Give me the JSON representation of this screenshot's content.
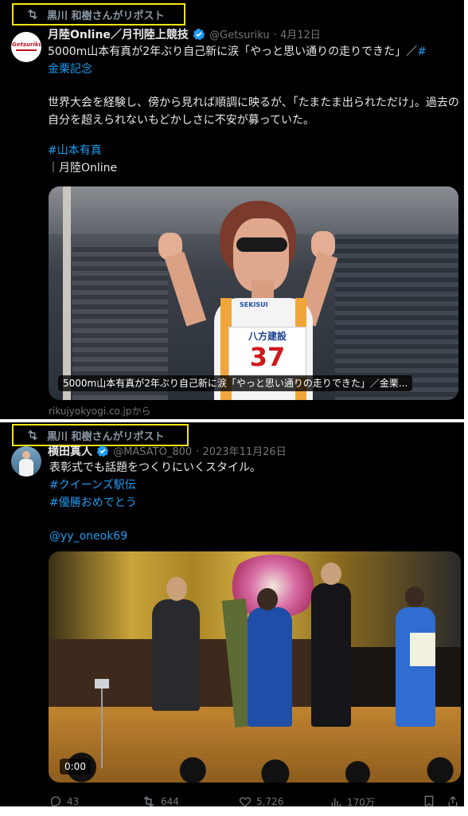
{
  "tweet1": {
    "retweeted_by": "黒川 和樹さんがリポスト",
    "avatar_text": "Getsuriku",
    "author_name": "月陸Online／月刊陸上競技",
    "handle": "@Getsuriku",
    "date": "· 4月12日",
    "headline_a": "5000m山本有真が2年ぶり自己新に涙「やっと思い通りの走りできた」／",
    "headline_hashtag_a": "#",
    "headline_hashtag_b": "金栗記念",
    "paragraph": "世界大会を経験し、傍から見れば順調に映るが、「たまたま出られただけ」。過去の自分を超えられないもどかしさに不安が募っていた。",
    "hashtag": "#山本有真",
    "source_line": "｜月陸Online",
    "card_caption": "5000m山本有真が2年ぶり自己新に涙「やっと思い通りの走りできた」／金栗...",
    "card_domain": "rikujyokyogi.co.jpから",
    "bib_sponsor": "八方建設",
    "bib_number": "37",
    "shirt_brand": "SEKISUI"
  },
  "tweet2": {
    "retweeted_by": "黒川 和樹さんがリポスト",
    "author_name": "横田真人",
    "handle": "@MASATO_800",
    "date": "· 2023年11月26日",
    "line1": "表彰式でも話題をつくりにいくスタイル。",
    "hashtag1": "#クイーンズ駅伝",
    "hashtag2": "#優勝おめでとう",
    "mention": "@yy_oneok69",
    "video_time": "0:00",
    "stats": {
      "replies": "43",
      "reposts": "644",
      "likes": "5,726",
      "views": "170万"
    }
  },
  "colors": {
    "accent": "#1d9bf0",
    "highlight": "#f5e614",
    "background": "#000000"
  }
}
